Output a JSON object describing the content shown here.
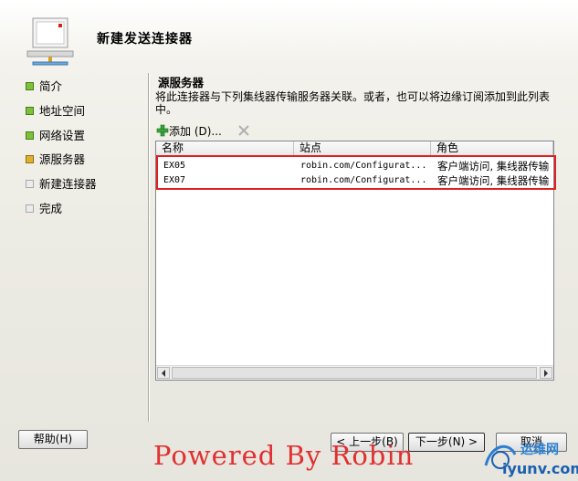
{
  "header": {
    "title": "新建发送连接器",
    "icon": "exchange-connector-icon"
  },
  "steps": [
    {
      "label": "简介",
      "state": "done"
    },
    {
      "label": "地址空间",
      "state": "done"
    },
    {
      "label": "网络设置",
      "state": "done"
    },
    {
      "label": "源服务器",
      "state": "current"
    },
    {
      "label": "新建连接器",
      "state": "pending"
    },
    {
      "label": "完成",
      "state": "pending"
    }
  ],
  "section": {
    "title": "源服务器",
    "description": "将此连接器与下列集线器传输服务器关联。或者，也可以将边缘订阅添加到此列表中。"
  },
  "toolbar": {
    "add_label": "添加 (D)...",
    "add_icon": "green-plus-icon",
    "remove_icon": "red-x-icon"
  },
  "table": {
    "columns": [
      "名称",
      "站点",
      "角色"
    ],
    "rows": [
      {
        "name": "EX05",
        "site": "robin.com/Configurat...",
        "role": "客户端访问, 集线器传输"
      },
      {
        "name": "EX07",
        "site": "robin.com/Configurat...",
        "role": "客户端访问, 集线器传输"
      }
    ]
  },
  "buttons": {
    "help": "帮助(H)",
    "back": "< 上一步(B)",
    "next": "下一步(N) >",
    "cancel": "取消"
  },
  "watermark": "Powered By Robin",
  "logo": {
    "text_cn": "运维网",
    "text_en": "iyunv.com"
  },
  "colors": {
    "highlight": "#e02020",
    "step_done": "#7fbf3a",
    "step_current": "#e0b12e",
    "watermark": "#e03030"
  }
}
